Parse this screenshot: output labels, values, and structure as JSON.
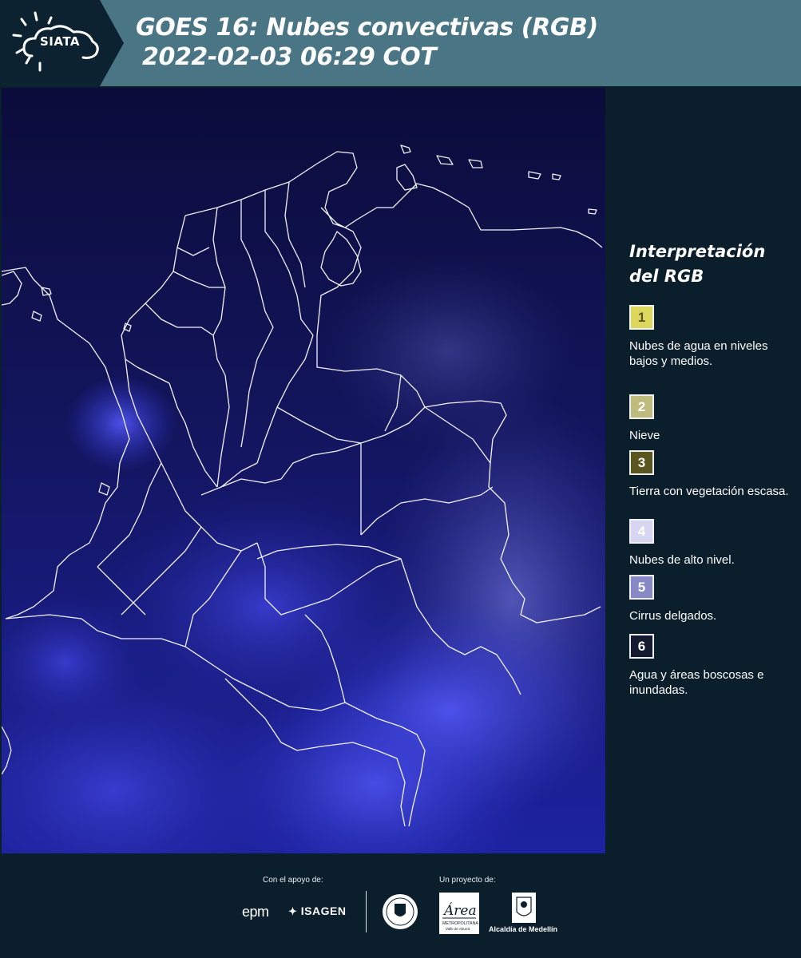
{
  "header": {
    "logo_text": "SIATA",
    "title_line1": "GOES 16: Nubes convectivas (RGB)",
    "title_line2": "2022-02-03 06:29 COT",
    "background_color": "#4a7585"
  },
  "legend": {
    "title_line1": "Interpretación",
    "title_line2": "del RGB",
    "items": [
      {
        "number": "1",
        "label": "Nubes de agua en niveles bajos y medios.",
        "color": "#dcd85e",
        "number_color": "#5a5520"
      },
      {
        "number": "2",
        "label": "Nieve",
        "color": "#bfbb7d",
        "number_color": "#ffffff"
      },
      {
        "number": "3",
        "label": "Tierra con vegetación escasa.",
        "color": "#5a5620",
        "number_color": "#ffffff"
      },
      {
        "number": "4",
        "label": "Nubes de alto nivel.",
        "color": "#d6d5f2",
        "number_color": "#ffffff"
      },
      {
        "number": "5",
        "label": "Cirrus delgados.",
        "color": "#8788c6",
        "number_color": "#ffffff"
      },
      {
        "number": "6",
        "label": "Agua y áreas boscosas e inundadas.",
        "color": "#141a30",
        "number_color": "#ffffff"
      }
    ]
  },
  "footer": {
    "support_label": "Con el apoyo de:",
    "project_label": "Un proyecto de:",
    "sponsors": [
      "epm",
      "ISAGEN"
    ],
    "partners": [
      "Área Metropolitana Valle de Aburrá",
      "Alcaldía de Medellín"
    ],
    "partner_small_text": "METROPOLITANA",
    "partner_small_text2": "Valle de Aburrá",
    "alcaldia_label": "Alcaldía de Medellín"
  },
  "map": {
    "description_colors": {
      "background": "#0e0f4a",
      "clouds": "#3a3fd8",
      "borders": "#ffffff"
    }
  }
}
